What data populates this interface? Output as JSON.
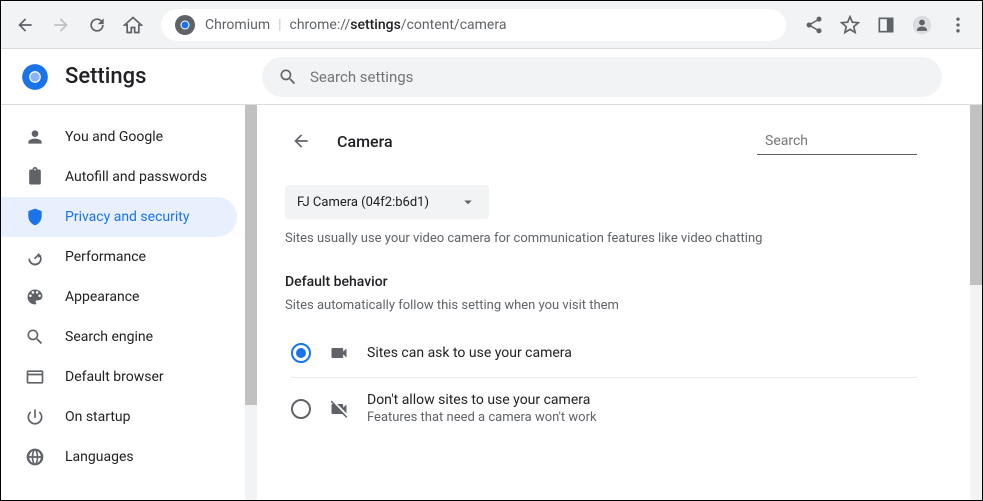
{
  "browser": {
    "url_prefix": "Chromium",
    "url_scheme": "chrome://",
    "url_bold": "settings",
    "url_rest": "/content/camera"
  },
  "header": {
    "title": "Settings",
    "search_placeholder": "Search settings"
  },
  "sidebar": {
    "items": [
      {
        "label": "You and Google",
        "icon": "person"
      },
      {
        "label": "Autofill and passwords",
        "icon": "assignment"
      },
      {
        "label": "Privacy and security",
        "icon": "shield",
        "active": true
      },
      {
        "label": "Performance",
        "icon": "speed"
      },
      {
        "label": "Appearance",
        "icon": "palette"
      },
      {
        "label": "Search engine",
        "icon": "search"
      },
      {
        "label": "Default browser",
        "icon": "web"
      },
      {
        "label": "On startup",
        "icon": "power"
      },
      {
        "label": "Languages",
        "icon": "globe"
      }
    ]
  },
  "content": {
    "page_title": "Camera",
    "header_search_placeholder": "Search",
    "camera_selected": "FJ Camera (04f2:b6d1)",
    "camera_desc": "Sites usually use your video camera for communication features like video chatting",
    "default_behavior_title": "Default behavior",
    "default_behavior_sub": "Sites automatically follow this setting when you visit them",
    "options": [
      {
        "label": "Sites can ask to use your camera",
        "sub": "",
        "checked": true,
        "icon": "videocam"
      },
      {
        "label": "Don't allow sites to use your camera",
        "sub": "Features that need a camera won't work",
        "checked": false,
        "icon": "videocam-off"
      }
    ]
  }
}
